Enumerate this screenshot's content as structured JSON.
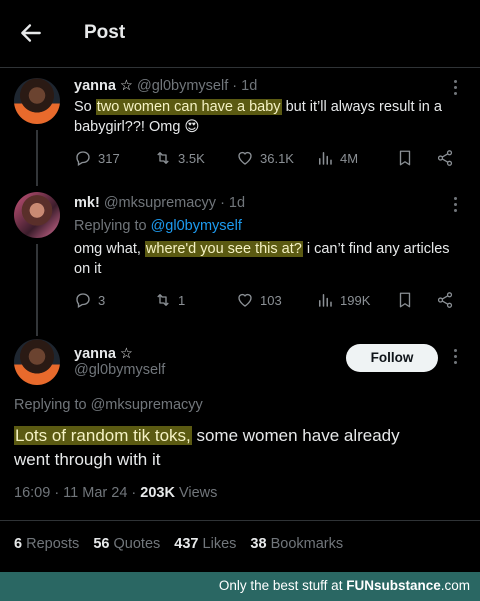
{
  "header": {
    "title": "Post"
  },
  "tweets": [
    {
      "name": "yanna ☆",
      "handle": "@gl0bymyself",
      "time": "· 1d",
      "text_before": "So ",
      "text_highlight": "two women can have a baby",
      "text_after": " but it’ll always result in a",
      "text_line2": "babygirl??! Omg 😍",
      "replies": "317",
      "reposts": "3.5K",
      "likes": "36.1K",
      "views": "4M"
    },
    {
      "name": "mk!",
      "handle": "@mksupremacyy",
      "time": "· 1d",
      "replying_prefix": "Replying to ",
      "replying_to": "@gl0bymyself",
      "text_before": "omg what, ",
      "text_highlight": "where'd you see this at?",
      "text_after": " i can’t find any articles",
      "text_line2": "on it",
      "replies": "3",
      "reposts": "1",
      "likes": "103",
      "views": "199K"
    }
  ],
  "main": {
    "name": "yanna ☆",
    "handle": "@gl0bymyself",
    "follow_label": "Follow",
    "replying": "Replying to @mksupremacyy",
    "text_highlight": "Lots of random tik toks,",
    "text_after": " some women have already",
    "text_line2": "went through with it",
    "time": "16:09 · 11 Mar 24 · ",
    "views_count": "203K",
    "views_label": " Views"
  },
  "stats": {
    "reposts_count": "6",
    "reposts_label": "Reposts",
    "quotes_count": "56",
    "quotes_label": "Quotes",
    "likes_count": "437",
    "likes_label": "Likes",
    "bookmarks_count": "38",
    "bookmarks_label": "Bookmarks"
  },
  "footer": {
    "prefix": "Only the best stuff at ",
    "brand": "FUNsubstance",
    "suffix": ".com"
  }
}
